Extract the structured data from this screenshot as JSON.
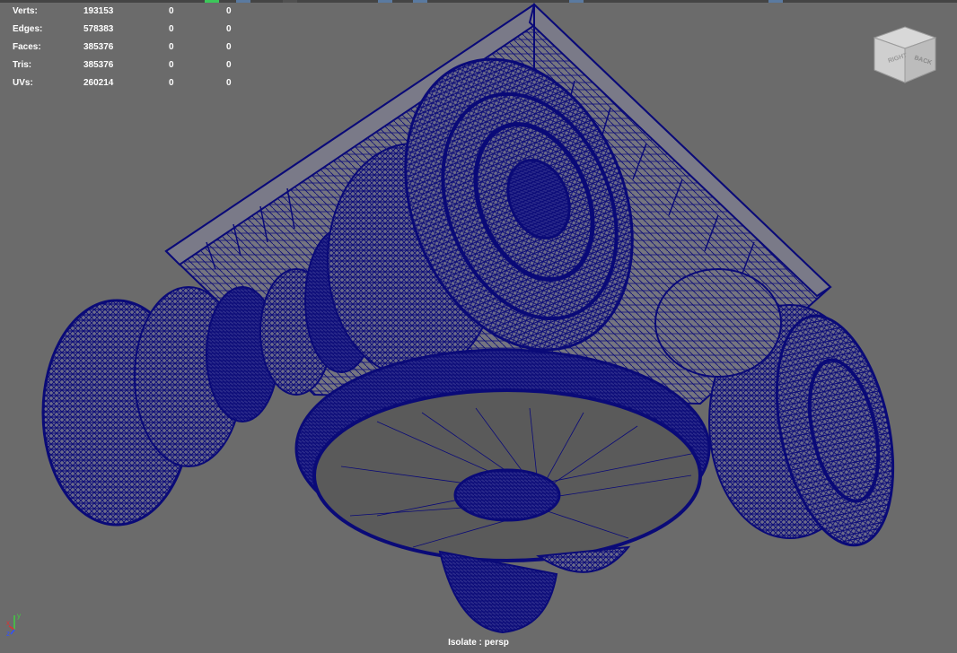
{
  "hud": {
    "rows": [
      {
        "label": "Verts:",
        "v1": "193153",
        "v2": "0",
        "v3": "0"
      },
      {
        "label": "Edges:",
        "v1": "578383",
        "v2": "0",
        "v3": "0"
      },
      {
        "label": "Faces:",
        "v1": "385376",
        "v2": "0",
        "v3": "0"
      },
      {
        "label": "Tris:",
        "v1": "385376",
        "v2": "0",
        "v3": "0"
      },
      {
        "label": "UVs:",
        "v1": "260214",
        "v2": "0",
        "v3": "0"
      }
    ]
  },
  "viewcube": {
    "face_right": "RIGHT",
    "face_back": "BACK"
  },
  "camera": {
    "label": "Isolate : persp"
  },
  "axis": {
    "y": "y",
    "x": "x",
    "z": "z"
  },
  "colors": {
    "background": "#6b6b6b",
    "wireframe": "#0a0a78",
    "hud_text": "#ffffff",
    "axis_x": "#e03030",
    "axis_y": "#40d040",
    "axis_z": "#3050ff"
  }
}
